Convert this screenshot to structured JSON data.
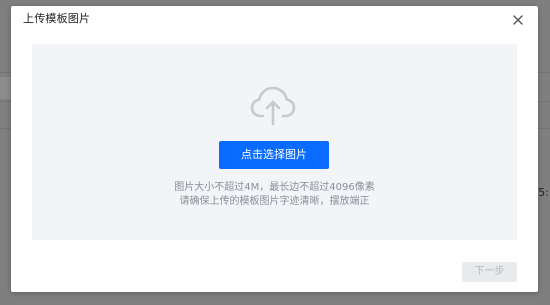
{
  "dialog": {
    "title": "上传模板图片",
    "close_icon": "close-icon"
  },
  "upload": {
    "icon": "cloud-upload-icon",
    "select_button_label": "点击选择图片",
    "hint_line1": "图片大小不超过4M，最长边不超过4096像素",
    "hint_line2": "请确保上传的模板图片字迹清晰，摆放端正"
  },
  "footer": {
    "next_label": "下一步",
    "next_disabled": true
  },
  "background": {
    "edge_char": "5:"
  },
  "colors": {
    "primary": "#0a6cff",
    "upload_area_bg": "#f3f4f7",
    "hint_text": "#8a8f99",
    "disabled_button_bg": "#e8eaee",
    "disabled_button_text": "#b3b7bf",
    "overlay": "#7f7f7f"
  }
}
